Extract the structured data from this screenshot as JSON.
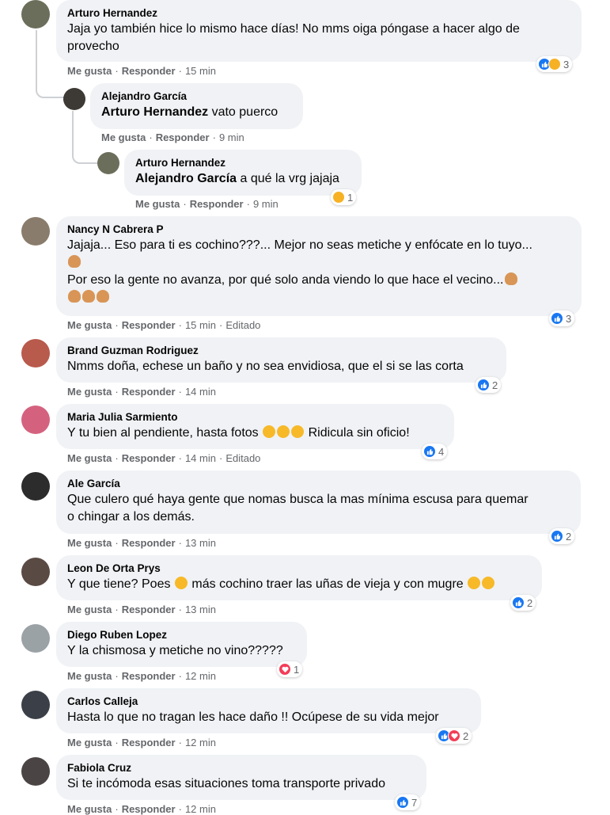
{
  "actions": {
    "like": "Me gusta",
    "reply": "Responder",
    "separator": "·",
    "edited": "Editado"
  },
  "comments": [
    {
      "author": "Arturo Hernandez",
      "text_line1": "Jaja yo también hice lo mismo hace días! No mms oiga póngase a hacer algo de",
      "text_line2": "provecho",
      "time": "15 min",
      "reactions": [
        "like",
        "haha"
      ],
      "count": "3",
      "avatar_color": "#6b6e5a"
    },
    {
      "author": "Alejandro García",
      "tag": "Arturo Hernandez",
      "text": "vato puerco",
      "time": "9 min",
      "avatar_color": "#3d3a36"
    },
    {
      "author": "Arturo Hernandez",
      "tag": "Alejandro García",
      "text": "a qué la vrg jajaja",
      "time": "9 min",
      "reactions": [
        "haha"
      ],
      "count": "1",
      "avatar_color": "#6b6e5a"
    },
    {
      "author": "Nancy N Cabrera P",
      "text_line1": "Jajaja... Eso para ti es cochino???... Mejor no seas metiche y enfócate en lo tuyo...",
      "text_line2": "Por eso la gente no avanza, por qué solo anda viendo lo que hace el vecino...",
      "time": "15 min",
      "edited": "Editado",
      "reactions": [
        "like"
      ],
      "count": "3",
      "avatar_color": "#8a7c6c"
    },
    {
      "author": "Brand Guzman Rodriguez",
      "text": "Nmms doña, echese un baño y no sea envidiosa, que el si se las corta",
      "time": "14 min",
      "reactions": [
        "like"
      ],
      "count": "2",
      "avatar_color": "#b85a4c"
    },
    {
      "author": "Maria Julia Sarmiento",
      "text_before": "Y tu bien al pendiente, hasta fotos",
      "text_after": "Ridicula sin oficio!",
      "time": "14 min",
      "edited": "Editado",
      "reactions": [
        "like"
      ],
      "count": "4",
      "avatar_color": "#d4627f"
    },
    {
      "author": "Ale García",
      "text_line1": "Que culero qué haya gente que nomas busca la mas mínima escusa para quemar",
      "text_line2": "o chingar a los demás.",
      "time": "13 min",
      "reactions": [
        "like"
      ],
      "count": "2",
      "avatar_color": "#2c2c2c"
    },
    {
      "author": "Leon De Orta Prys",
      "text_before": "Y que tiene? Poes",
      "text_after": "más cochino traer las uñas de vieja y con mugre",
      "time": "13 min",
      "reactions": [
        "like"
      ],
      "count": "2",
      "avatar_color": "#5a4a44"
    },
    {
      "author": "Diego Ruben Lopez",
      "text": "Y la chismosa y metiche no vino?????",
      "time": "12 min",
      "reactions": [
        "love"
      ],
      "count": "1",
      "avatar_color": "#9aa2a6"
    },
    {
      "author": "Carlos Calleja",
      "text": "Hasta lo que no tragan les hace daño !! Ocúpese de su vida mejor",
      "time": "12 min",
      "reactions": [
        "like",
        "love"
      ],
      "count": "2",
      "avatar_color": "#3b3f47"
    },
    {
      "author": "Fabiola Cruz",
      "text": "Si te incómoda esas situaciones toma transporte privado",
      "time": "12 min",
      "reactions": [
        "like"
      ],
      "count": "7",
      "avatar_color": "#4b4444"
    }
  ]
}
